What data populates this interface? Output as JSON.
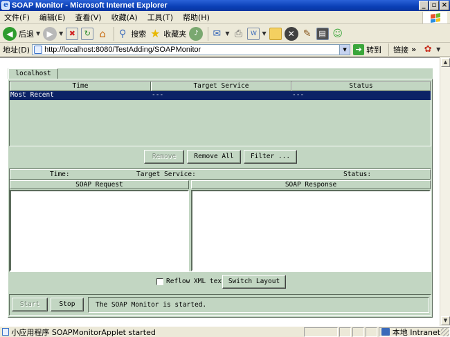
{
  "window": {
    "title": "SOAP Monitor - Microsoft Internet Explorer",
    "controls": [
      "_",
      "▫",
      "×"
    ]
  },
  "menu": {
    "items": [
      "文件(F)",
      "编辑(E)",
      "查看(V)",
      "收藏(A)",
      "工具(T)",
      "帮助(H)"
    ]
  },
  "toolbar": {
    "back_label": "后退",
    "search_label": "搜索",
    "favorites_label": "收藏夹"
  },
  "address": {
    "label": "地址(D)",
    "url": "http://localhost:8080/TestAdding/SOAPMonitor",
    "go_label": "转到",
    "links_label": "链接",
    "links_more": "»"
  },
  "applet": {
    "host_tab": "localhost",
    "list": {
      "columns": [
        "Time",
        "Target Service",
        "Status"
      ],
      "rows": [
        {
          "time": "Most Recent",
          "target": "---",
          "status": "---"
        }
      ]
    },
    "buttons": {
      "remove": "Remove",
      "remove_all": "Remove All",
      "filter": "Filter ..."
    },
    "detail": {
      "time_label": "Time:",
      "target_label": "Target Service:",
      "status_label": "Status:",
      "request_title": "SOAP Request",
      "response_title": "SOAP Response"
    },
    "options": {
      "reflow_label": "Reflow XML text",
      "reflow_checked": false,
      "switch_layout": "Switch Layout"
    },
    "control": {
      "start": "Start",
      "stop": "Stop",
      "message": "The SOAP Monitor is started."
    }
  },
  "statusbar": {
    "text": "小应用程序 SOAPMonitorApplet started",
    "zone": "本地 Intranet"
  },
  "colors": {
    "titlebar": "#0a3fb6",
    "applet_bg": "#c2d6c2",
    "selection": "#0b2266"
  }
}
